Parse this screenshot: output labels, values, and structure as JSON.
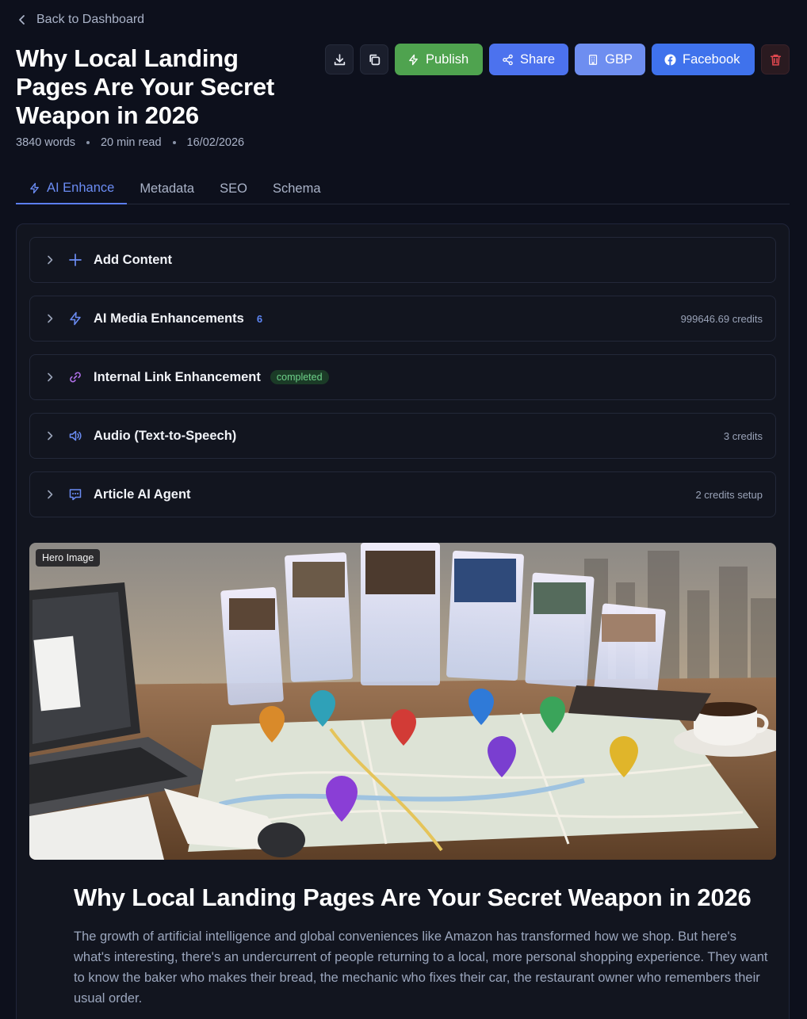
{
  "nav": {
    "back_label": "Back to Dashboard"
  },
  "article": {
    "title": "Why Local Landing Pages Are Your Secret Weapon in 2026",
    "words": "3840 words",
    "read_time": "20 min read",
    "date": "16/02/2026"
  },
  "toolbar": {
    "publish_label": "Publish",
    "share_label": "Share",
    "gbp_label": "GBP",
    "facebook_label": "Facebook"
  },
  "tabs": [
    {
      "label": "AI Enhance",
      "active": true
    },
    {
      "label": "Metadata"
    },
    {
      "label": "SEO"
    },
    {
      "label": "Schema"
    }
  ],
  "sections": [
    {
      "label": "Add Content",
      "icon": "plus-icon",
      "right": ""
    },
    {
      "label": "AI Media Enhancements",
      "icon": "lightning-icon",
      "count": "6",
      "right": "999646.69 credits"
    },
    {
      "label": "Internal Link Enhancement",
      "icon": "link-icon",
      "badge": "completed",
      "right": ""
    },
    {
      "label": "Audio (Text-to-Speech)",
      "icon": "speaker-icon",
      "right": "3 credits"
    },
    {
      "label": "Article AI Agent",
      "icon": "chat-icon",
      "right": "2 credits setup"
    }
  ],
  "hero": {
    "tag": "Hero Image"
  },
  "content": {
    "heading": "Why Local Landing Pages Are Your Secret Weapon in 2026",
    "paragraph": "The growth of artificial intelligence and global conveniences like Amazon has transformed how we shop. But here's what's interesting, there's an undercurrent of people returning to a local, more personal shopping experience. They want to know the baker who makes their bread, the mechanic who fixes their car, the restaurant owner who remembers their usual order."
  },
  "colors": {
    "background": "#0d101c",
    "accent": "#5b7ef0",
    "publish": "#4fa34f",
    "facebook": "#3f72ec",
    "delete": "#e0484f",
    "badge_completed": "#6ed18a"
  }
}
